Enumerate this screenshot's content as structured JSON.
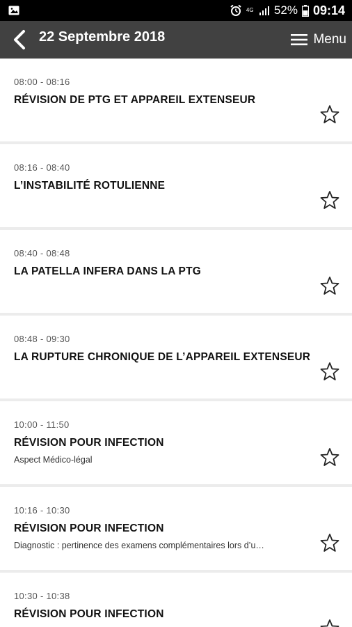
{
  "status_bar": {
    "battery": "52%",
    "time": "09:14",
    "network": "4G"
  },
  "header": {
    "title": "22 Septembre 2018",
    "menu_label": "Menu"
  },
  "sessions": [
    {
      "time": "08:00 - 08:16",
      "title": "RÉVISION DE PTG ET APPAREIL EXTENSEUR",
      "subtitle": ""
    },
    {
      "time": "08:16 - 08:40",
      "title": "L’INSTABILITÉ ROTULIENNE",
      "subtitle": ""
    },
    {
      "time": "08:40 - 08:48",
      "title": "LA PATELLA INFERA DANS LA PTG",
      "subtitle": ""
    },
    {
      "time": "08:48 - 09:30",
      "title": "LA RUPTURE CHRONIQUE DE L’APPAREIL EXTENSEUR",
      "subtitle": ""
    },
    {
      "time": "10:00 - 11:50",
      "title": "RÉVISION POUR INFECTION",
      "subtitle": "Aspect Médico-légal"
    },
    {
      "time": "10:16 - 10:30",
      "title": "RÉVISION POUR INFECTION",
      "subtitle": "Diagnostic : pertinence des examens complémentaires lors d’u…"
    },
    {
      "time": "10:30 - 10:38",
      "title": "RÉVISION POUR INFECTION",
      "subtitle": ""
    }
  ]
}
